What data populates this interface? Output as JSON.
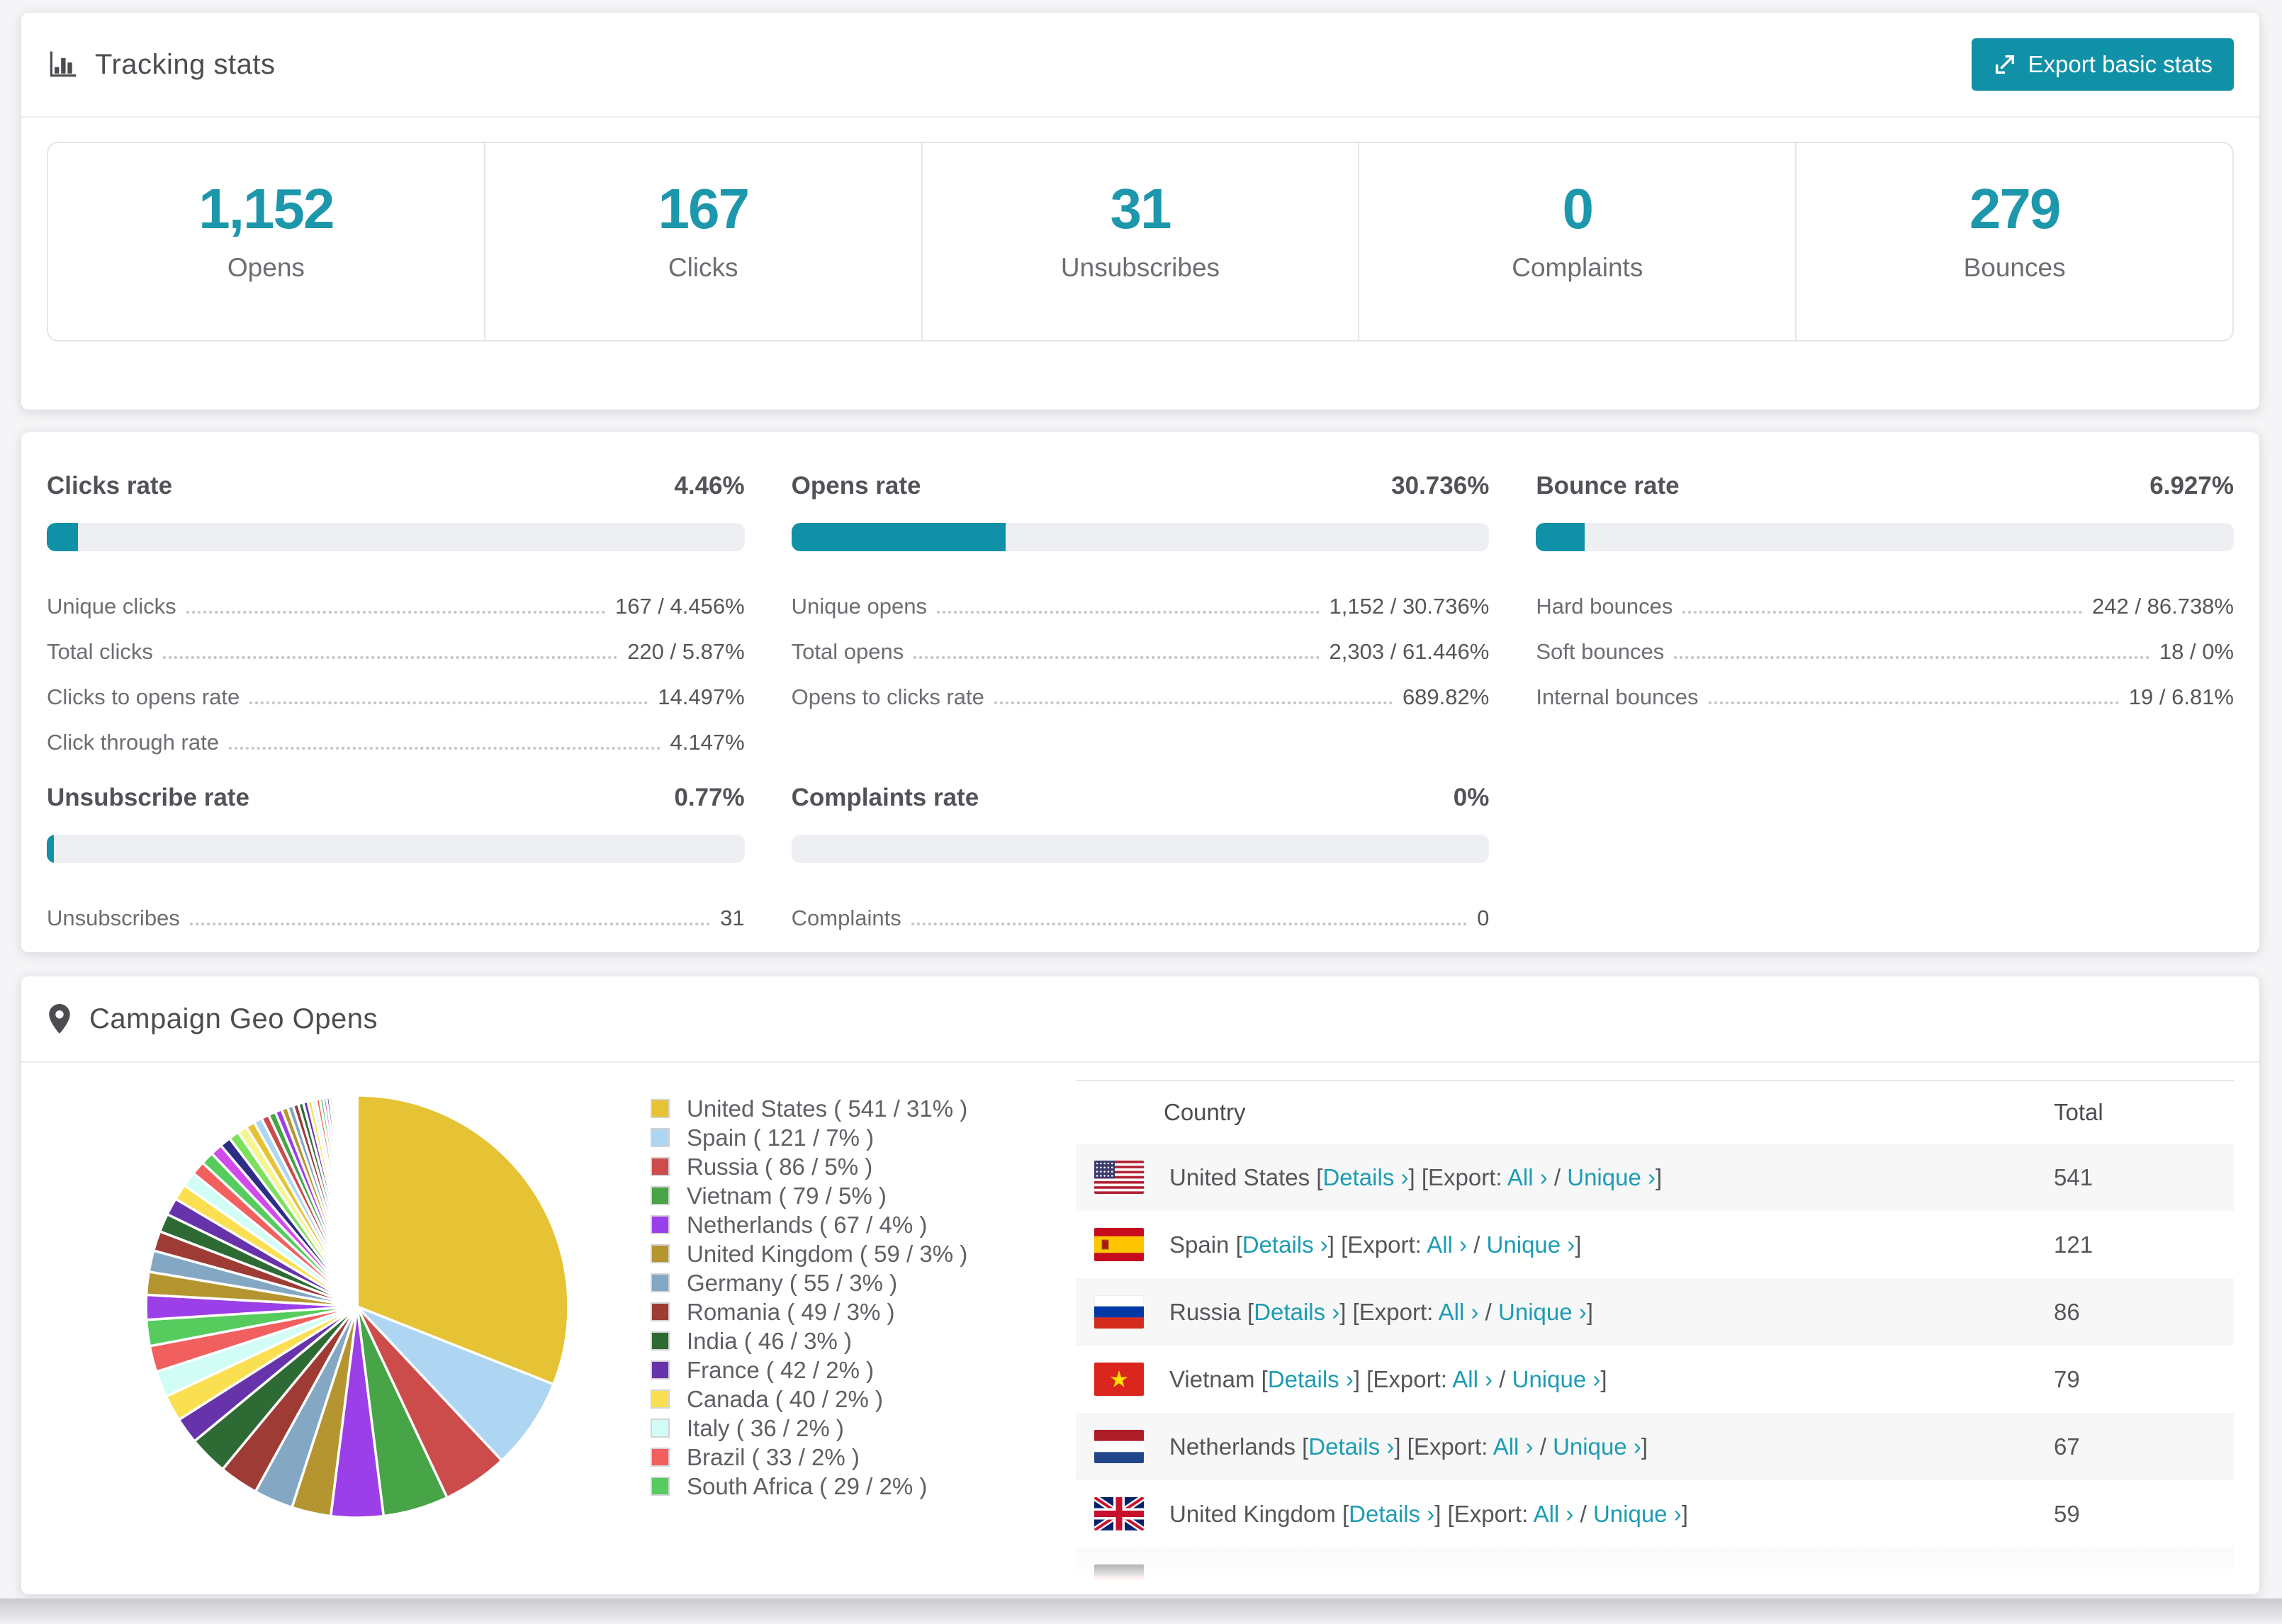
{
  "colors": {
    "accent_teal": "#1191a8",
    "stat_teal": "#1d97ac",
    "link_teal": "#1d9cb2",
    "bar_track": "#edeff3",
    "stripe_bg": "#f7f7f8",
    "page_bg": "#f5f5f7"
  },
  "header": {
    "icon": "bar-chart-icon",
    "title": "Tracking stats",
    "export_button": {
      "icon": "export-icon",
      "label": "Export basic stats"
    }
  },
  "summary": [
    {
      "value": "1,152",
      "label": "Opens"
    },
    {
      "value": "167",
      "label": "Clicks"
    },
    {
      "value": "31",
      "label": "Unsubscribes"
    },
    {
      "value": "0",
      "label": "Complaints"
    },
    {
      "value": "279",
      "label": "Bounces"
    }
  ],
  "rates": [
    {
      "title": "Clicks rate",
      "value": "4.46%",
      "pct": 4.46,
      "rows": [
        {
          "label": "Unique clicks",
          "value": "167 / 4.456%"
        },
        {
          "label": "Total clicks",
          "value": "220 / 5.87%"
        },
        {
          "label": "Clicks to opens rate",
          "value": "14.497%"
        },
        {
          "label": "Click through rate",
          "value": "4.147%"
        }
      ]
    },
    {
      "title": "Opens rate",
      "value": "30.736%",
      "pct": 30.736,
      "rows": [
        {
          "label": "Unique opens",
          "value": "1,152 / 30.736%"
        },
        {
          "label": "Total opens",
          "value": "2,303 / 61.446%"
        },
        {
          "label": "Opens to clicks rate",
          "value": "689.82%"
        }
      ]
    },
    {
      "title": "Bounce rate",
      "value": "6.927%",
      "pct": 6.927,
      "rows": [
        {
          "label": "Hard bounces",
          "value": "242 / 86.738%"
        },
        {
          "label": "Soft bounces",
          "value": "18 / 0%"
        },
        {
          "label": "Internal bounces",
          "value": "19 / 6.81%"
        }
      ]
    },
    {
      "title": "Unsubscribe rate",
      "value": "0.77%",
      "pct": 0.77,
      "rows": [
        {
          "label": "Unsubscribes",
          "value": "31"
        }
      ]
    },
    {
      "title": "Complaints rate",
      "value": "0%",
      "pct": 0,
      "rows": [
        {
          "label": "Complaints",
          "value": "0"
        }
      ]
    }
  ],
  "geo": {
    "icon": "map-pin-icon",
    "title": "Campaign Geo Opens",
    "chart_data": {
      "type": "pie",
      "title": "Campaign Geo Opens",
      "labels": [
        "United States",
        "Spain",
        "Russia",
        "Vietnam",
        "Netherlands",
        "United Kingdom",
        "Germany",
        "Romania",
        "India",
        "France",
        "Canada",
        "Italy",
        "Brazil",
        "South Africa"
      ],
      "values": [
        541,
        121,
        86,
        79,
        67,
        59,
        55,
        49,
        46,
        42,
        40,
        36,
        33,
        29
      ],
      "pct": [
        31,
        7,
        5,
        5,
        4,
        3,
        3,
        3,
        3,
        2,
        2,
        2,
        2,
        2
      ],
      "others_pct": 26,
      "colors": [
        "#e6c335",
        "#aed5f2",
        "#cc4b4b",
        "#47a447",
        "#9b3fe8",
        "#b5952f",
        "#84a8c4",
        "#9e3b35",
        "#2e6b34",
        "#6733aa",
        "#fae051",
        "#d2fcf6",
        "#f25f5f",
        "#56cb5e"
      ],
      "tail_extra_colors": [
        "#d24bea",
        "#2d2d86",
        "#7de05c",
        "#f5f58f"
      ],
      "start_angle_deg": -90,
      "direction": "clockwise",
      "legend_position": "right",
      "legend_item_format": "{label} ( {value} / {pct}% )"
    },
    "table": {
      "columns": [
        "Country",
        "Total"
      ],
      "links": {
        "details": "Details",
        "export_prefix": "Export:",
        "all": "All",
        "unique": "Unique",
        "chevron": "›"
      },
      "rows": [
        {
          "flag": "us",
          "country": "United States",
          "total": "541"
        },
        {
          "flag": "es",
          "country": "Spain",
          "total": "121"
        },
        {
          "flag": "ru",
          "country": "Russia",
          "total": "86"
        },
        {
          "flag": "vn",
          "country": "Vietnam",
          "total": "79"
        },
        {
          "flag": "nl",
          "country": "Netherlands",
          "total": "67"
        },
        {
          "flag": "gb",
          "country": "United Kingdom",
          "total": "59"
        },
        {
          "flag": "de",
          "country": "",
          "total": "",
          "clipped": true
        }
      ]
    }
  }
}
